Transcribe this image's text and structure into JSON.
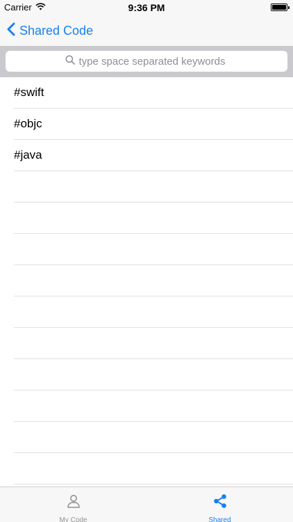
{
  "status_bar": {
    "carrier": "Carrier",
    "time": "9:36 PM"
  },
  "nav": {
    "back_label": "Shared Code"
  },
  "search": {
    "placeholder": "type space separated keywords"
  },
  "list": {
    "items": [
      "#swift",
      "#objc",
      "#java"
    ]
  },
  "tab_bar": {
    "tabs": [
      {
        "label": "My Code",
        "icon": "person-icon",
        "active": false
      },
      {
        "label": "Shared",
        "icon": "share-icon",
        "active": true
      }
    ]
  },
  "colors": {
    "accent": "#1a7ff0",
    "inactive": "#929292",
    "search_bg": "#c9c9ce",
    "bar_bg": "#f7f7f7"
  }
}
